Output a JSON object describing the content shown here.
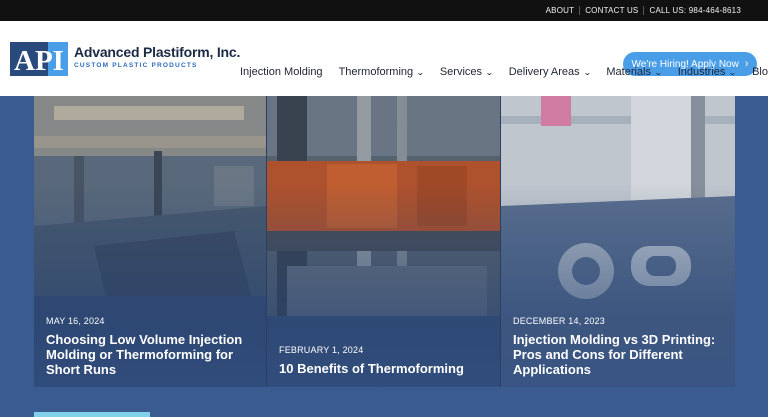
{
  "topbar": {
    "links": [
      "ABOUT",
      "CONTACT US",
      "CALL US: 984-464-8613"
    ]
  },
  "logo": {
    "mark": "API",
    "title": "Advanced Plastiform, Inc.",
    "subtitle": "CUSTOM PLASTIC PRODUCTS"
  },
  "header": {
    "hire_label": "We're Hiring! Apply Now",
    "hire_icon": "chevron-right-icon"
  },
  "nav": {
    "items": [
      {
        "label": "Injection Molding",
        "dropdown": false
      },
      {
        "label": "Thermoforming",
        "dropdown": true
      },
      {
        "label": "Services",
        "dropdown": true
      },
      {
        "label": "Delivery Areas",
        "dropdown": true
      },
      {
        "label": "Materials",
        "dropdown": true
      },
      {
        "label": "Industries",
        "dropdown": true
      },
      {
        "label": "Blog",
        "dropdown": false
      }
    ]
  },
  "posts": [
    {
      "date": "MAY 16, 2024",
      "title": "Choosing Low Volume Injection Molding or Thermoforming for Short Runs"
    },
    {
      "date": "FEBRUARY 1, 2024",
      "title": "10 Benefits of Thermoforming"
    },
    {
      "date": "DECEMBER 14, 2023",
      "title": "Injection Molding vs 3D Printing: Pros and Cons for Different Applications"
    }
  ],
  "colors": {
    "topbar": "#111111",
    "accent": "#4a9ee8",
    "brand_blue": "#2a4a7e",
    "page_bg": "#3a5b8f"
  }
}
